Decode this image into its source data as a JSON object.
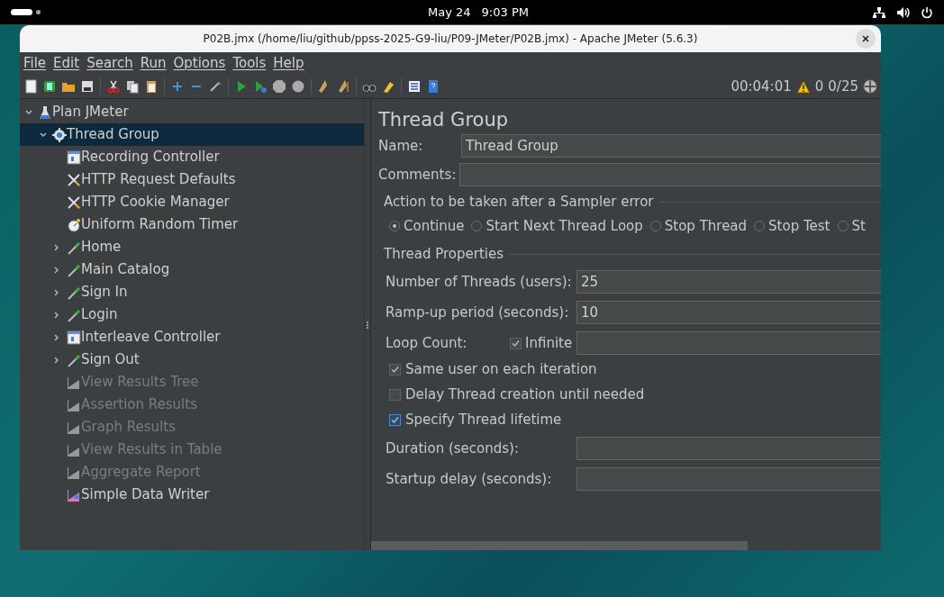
{
  "top_bar": {
    "date": "May 24",
    "time": "9:03 PM"
  },
  "window": {
    "title": "P02B.jmx (/home/liu/github/ppss-2025-G9-liu/P09-JMeter/P02B.jmx) - Apache JMeter (5.6.3)"
  },
  "menu": [
    "File",
    "Edit",
    "Search",
    "Run",
    "Options",
    "Tools",
    "Help"
  ],
  "status": {
    "elapsed": "00:04:01",
    "warnings": "0",
    "threads": "0/25"
  },
  "tree": [
    {
      "label": "Plan JMeter",
      "kind": "plan",
      "expanded": true,
      "selected": false,
      "disabled": false,
      "children": [
        {
          "label": "Thread Group",
          "kind": "threadgroup",
          "expanded": true,
          "selected": true,
          "disabled": false,
          "children": [
            {
              "label": "Recording Controller",
              "kind": "controller",
              "selected": false,
              "disabled": false
            },
            {
              "label": "HTTP Request Defaults",
              "kind": "config",
              "selected": false,
              "disabled": false
            },
            {
              "label": "HTTP Cookie Manager",
              "kind": "config",
              "selected": false,
              "disabled": false
            },
            {
              "label": "Uniform Random Timer",
              "kind": "timer",
              "selected": false,
              "disabled": false
            },
            {
              "label": "Home",
              "kind": "sampler",
              "expanded": false,
              "selected": false,
              "disabled": false
            },
            {
              "label": "Main Catalog",
              "kind": "sampler",
              "expanded": false,
              "selected": false,
              "disabled": false
            },
            {
              "label": "Sign In",
              "kind": "sampler",
              "expanded": false,
              "selected": false,
              "disabled": false
            },
            {
              "label": "Login",
              "kind": "sampler",
              "expanded": false,
              "selected": false,
              "disabled": false
            },
            {
              "label": "Interleave Controller",
              "kind": "controller",
              "expanded": false,
              "selected": false,
              "disabled": false
            },
            {
              "label": "Sign Out",
              "kind": "sampler",
              "expanded": false,
              "selected": false,
              "disabled": false
            },
            {
              "label": "View Results Tree",
              "kind": "listener",
              "selected": false,
              "disabled": true
            },
            {
              "label": "Assertion Results",
              "kind": "listener",
              "selected": false,
              "disabled": true
            },
            {
              "label": "Graph Results",
              "kind": "listener",
              "selected": false,
              "disabled": true
            },
            {
              "label": "View Results in Table",
              "kind": "listener",
              "selected": false,
              "disabled": true
            },
            {
              "label": "Aggregate Report",
              "kind": "listener",
              "selected": false,
              "disabled": true
            },
            {
              "label": "Simple Data Writer",
              "kind": "writer",
              "selected": false,
              "disabled": false
            }
          ]
        }
      ]
    }
  ],
  "panel": {
    "title": "Thread Group",
    "name": {
      "label": "Name:",
      "value": "Thread Group"
    },
    "comments": {
      "label": "Comments:"
    },
    "error_action": {
      "legend": "Action to be taken after a Sampler error",
      "options": [
        {
          "label": "Continue",
          "selected": true
        },
        {
          "label": "Start Next Thread Loop",
          "selected": false
        },
        {
          "label": "Stop Thread",
          "selected": false
        },
        {
          "label": "Stop Test",
          "selected": false
        },
        {
          "label": "St",
          "selected": false
        }
      ]
    },
    "properties": {
      "legend": "Thread Properties",
      "threads": {
        "label": "Number of Threads (users):",
        "value": "25"
      },
      "ramp_up": {
        "label": "Ramp-up period (seconds):",
        "value": "10"
      },
      "loop_count": {
        "label": "Loop Count:",
        "infinite_label": "Infinite",
        "infinite_checked": true
      },
      "options": [
        {
          "label": "Same user on each iteration",
          "checked": true,
          "focused": false
        },
        {
          "label": "Delay Thread creation until needed",
          "checked": false,
          "focused": false
        },
        {
          "label": "Specify Thread lifetime",
          "checked": true,
          "focused": true
        }
      ],
      "duration": {
        "label": "Duration (seconds):"
      },
      "startup_delay": {
        "label": "Startup delay (seconds):"
      }
    }
  }
}
